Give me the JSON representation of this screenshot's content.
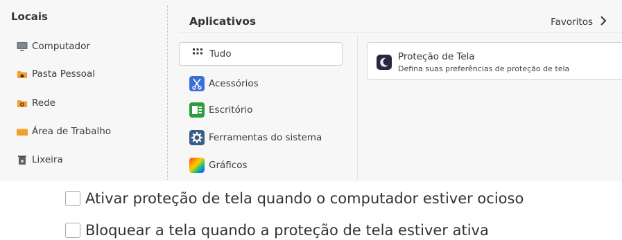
{
  "menu": {
    "places_title": "Locais",
    "places": [
      {
        "label": "Computador",
        "icon": "computer-icon"
      },
      {
        "label": "Pasta Pessoal",
        "icon": "home-folder-icon"
      },
      {
        "label": "Rede",
        "icon": "network-folder-icon"
      },
      {
        "label": "Área de Trabalho",
        "icon": "desktop-folder-icon"
      },
      {
        "label": "Lixeira",
        "icon": "trash-icon"
      }
    ],
    "apps_title": "Aplicativos",
    "favorites_label": "Favoritos",
    "categories": [
      {
        "label": "Tudo",
        "icon": "grid-icon",
        "active": true
      },
      {
        "label": "Acessórios",
        "icon": "accessories-icon"
      },
      {
        "label": "Escritório",
        "icon": "office-icon"
      },
      {
        "label": "Ferramentas do sistema",
        "icon": "system-tools-icon"
      },
      {
        "label": "Gráficos",
        "icon": "graphics-icon"
      }
    ],
    "apps": [
      {
        "name": "Proteção de Tela",
        "description": "Defina suas preferências de proteção de tela",
        "icon": "moon-screensaver-icon"
      }
    ]
  },
  "settings": {
    "activate_label": "Ativar proteção de tela quando o computador estiver ocioso",
    "lock_label": "Bloquear a tela quando a proteção de tela estiver ativa"
  },
  "colors": {
    "menu_bg": "#f7f7f7",
    "folder_orange": "#f0a030",
    "accessories_blue": "#3b6fd8",
    "office_green": "#2e9b3c",
    "system_blue": "#3a5f85",
    "screensaver_dark": "#2d2640"
  }
}
